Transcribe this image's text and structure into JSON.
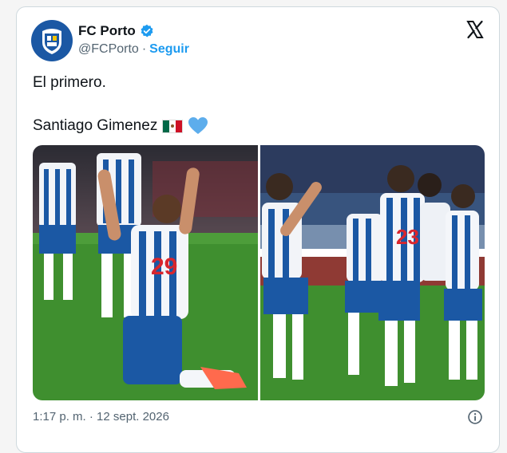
{
  "account": {
    "name": "FC Porto",
    "handle": "@FCPorto",
    "separator": "·",
    "follow_label": "Seguir"
  },
  "tweet": {
    "line1": "El primero.",
    "line2": "Santiago Gimenez"
  },
  "meta": {
    "timestamp": "1:17 p. m. · 12 sept. 2026"
  },
  "icons": {
    "verified": "verified-badge-icon",
    "x": "x-logo-icon",
    "info": "info-icon",
    "flag": "mexico-flag-emoji",
    "heart": "blue-heart-emoji"
  },
  "colors": {
    "link": "#1d9bf0",
    "porto_blue": "#1b58a4",
    "pitch": "#3f8f2f"
  }
}
